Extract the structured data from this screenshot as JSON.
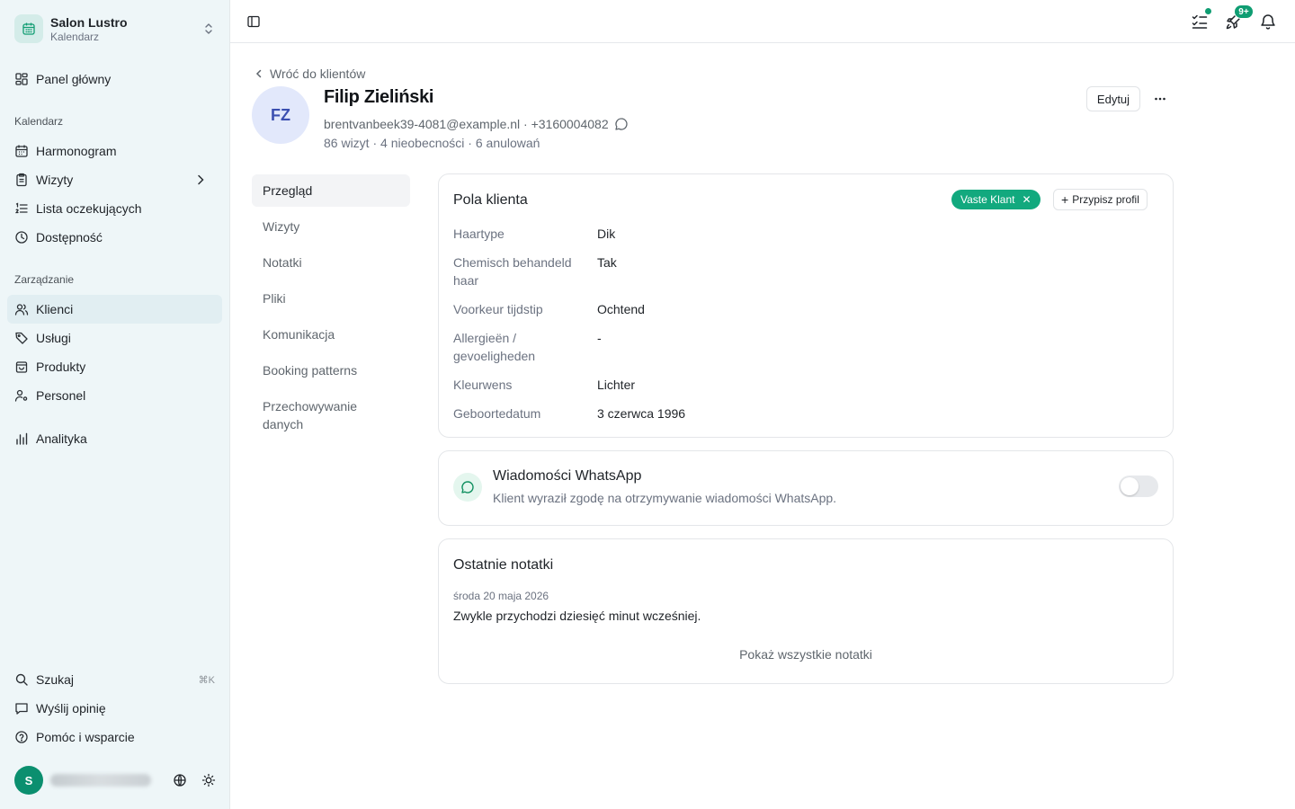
{
  "workspace": {
    "name": "Salon Lustro",
    "subtitle": "Kalendarz"
  },
  "sidebar": {
    "dashboard": "Panel główny",
    "calendar_section": "Kalendarz",
    "calendar_items": [
      "Harmonogram",
      "Wizyty",
      "Lista oczekujących",
      "Dostępność"
    ],
    "management_section": "Zarządzanie",
    "management_items": [
      "Klienci",
      "Usługi",
      "Produkty",
      "Personel"
    ],
    "analytics": "Analityka",
    "search": "Szukaj",
    "search_shortcut": "⌘K",
    "feedback": "Wyślij opinię",
    "help": "Pomóc i wsparcie",
    "user_initial": "S"
  },
  "topbar": {
    "notifications_badge": "9+"
  },
  "client": {
    "back": "Wróć do klientów",
    "initials": "FZ",
    "name": "Filip Zieliński",
    "contact": "brentvanbeek39-4081@example.nl · +3160004082",
    "stats": "86 wizyt · 4 nieobecności · 6 anulowań",
    "edit": "Edytuj"
  },
  "subnav": [
    "Przegląd",
    "Wizyty",
    "Notatki",
    "Pliki",
    "Komunikacja",
    "Booking patterns",
    "Przechowywanie danych"
  ],
  "fields_card": {
    "title": "Pola klienta",
    "tag": "Vaste Klant",
    "assign": "Przypisz profil",
    "rows": [
      {
        "label": "Haartype",
        "value": "Dik"
      },
      {
        "label": "Chemisch behandeld haar",
        "value": "Tak"
      },
      {
        "label": "Voorkeur tijdstip",
        "value": "Ochtend"
      },
      {
        "label": "Allergieën / gevoeligheden",
        "value": "-"
      },
      {
        "label": "Kleurwens",
        "value": "Lichter"
      },
      {
        "label": "Geboortedatum",
        "value": "3 czerwca 1996"
      }
    ]
  },
  "whatsapp": {
    "title": "Wiadomości WhatsApp",
    "subtitle": "Klient wyraził zgodę na otrzymywanie wiadomości WhatsApp.",
    "enabled": false
  },
  "notes": {
    "title": "Ostatnie notatki",
    "date": "środa 20 maja 2026",
    "text": "Zwykle przychodzi dziesięć minut wcześniej.",
    "show_all": "Pokaż wszystkie notatki"
  },
  "colors": {
    "accent": "#12a97e",
    "sidebar_bg": "#eef6f8",
    "avatar_bg": "#e2e8fb"
  }
}
